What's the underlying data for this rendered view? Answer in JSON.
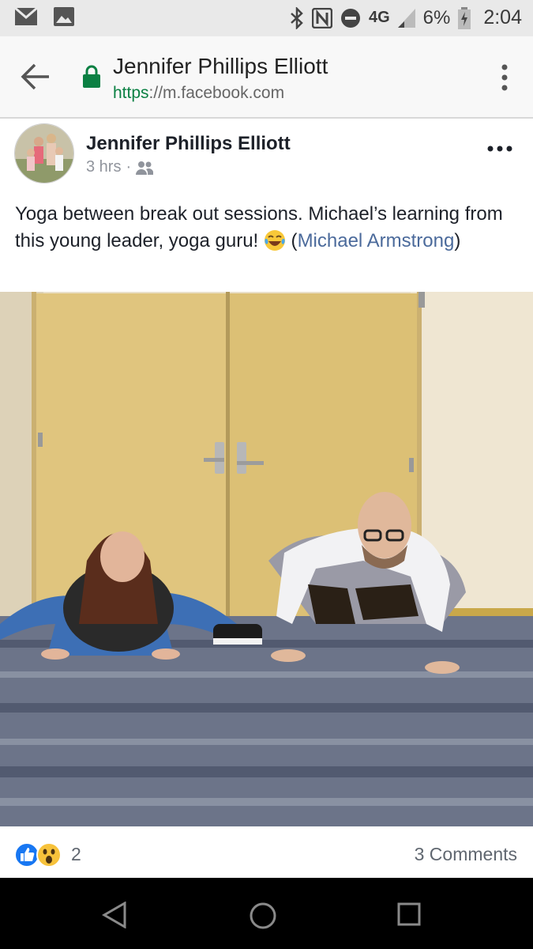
{
  "status_bar": {
    "network": "4G",
    "battery": "6%",
    "time": "2:04"
  },
  "browser": {
    "title": "Jennifer Phillips Elliott",
    "url_scheme": "https",
    "url_rest": "://m.facebook.com"
  },
  "post": {
    "author": "Jennifer Phillips Elliott",
    "time": "3 hrs",
    "separator": "·",
    "audience_icon": "friends-icon",
    "text_main": "Yoga between break out sessions. Michael’s learning from this young leader, yoga guru! ",
    "text_paren_open": " (",
    "mention": "Michael Armstrong",
    "text_paren_close": ")",
    "reactions": [
      "like",
      "wow"
    ],
    "reaction_count": "2",
    "comments": "3 Comments"
  },
  "colors": {
    "link": "#4b6a9b",
    "secure": "#0b8043",
    "like": "#1877f2"
  }
}
